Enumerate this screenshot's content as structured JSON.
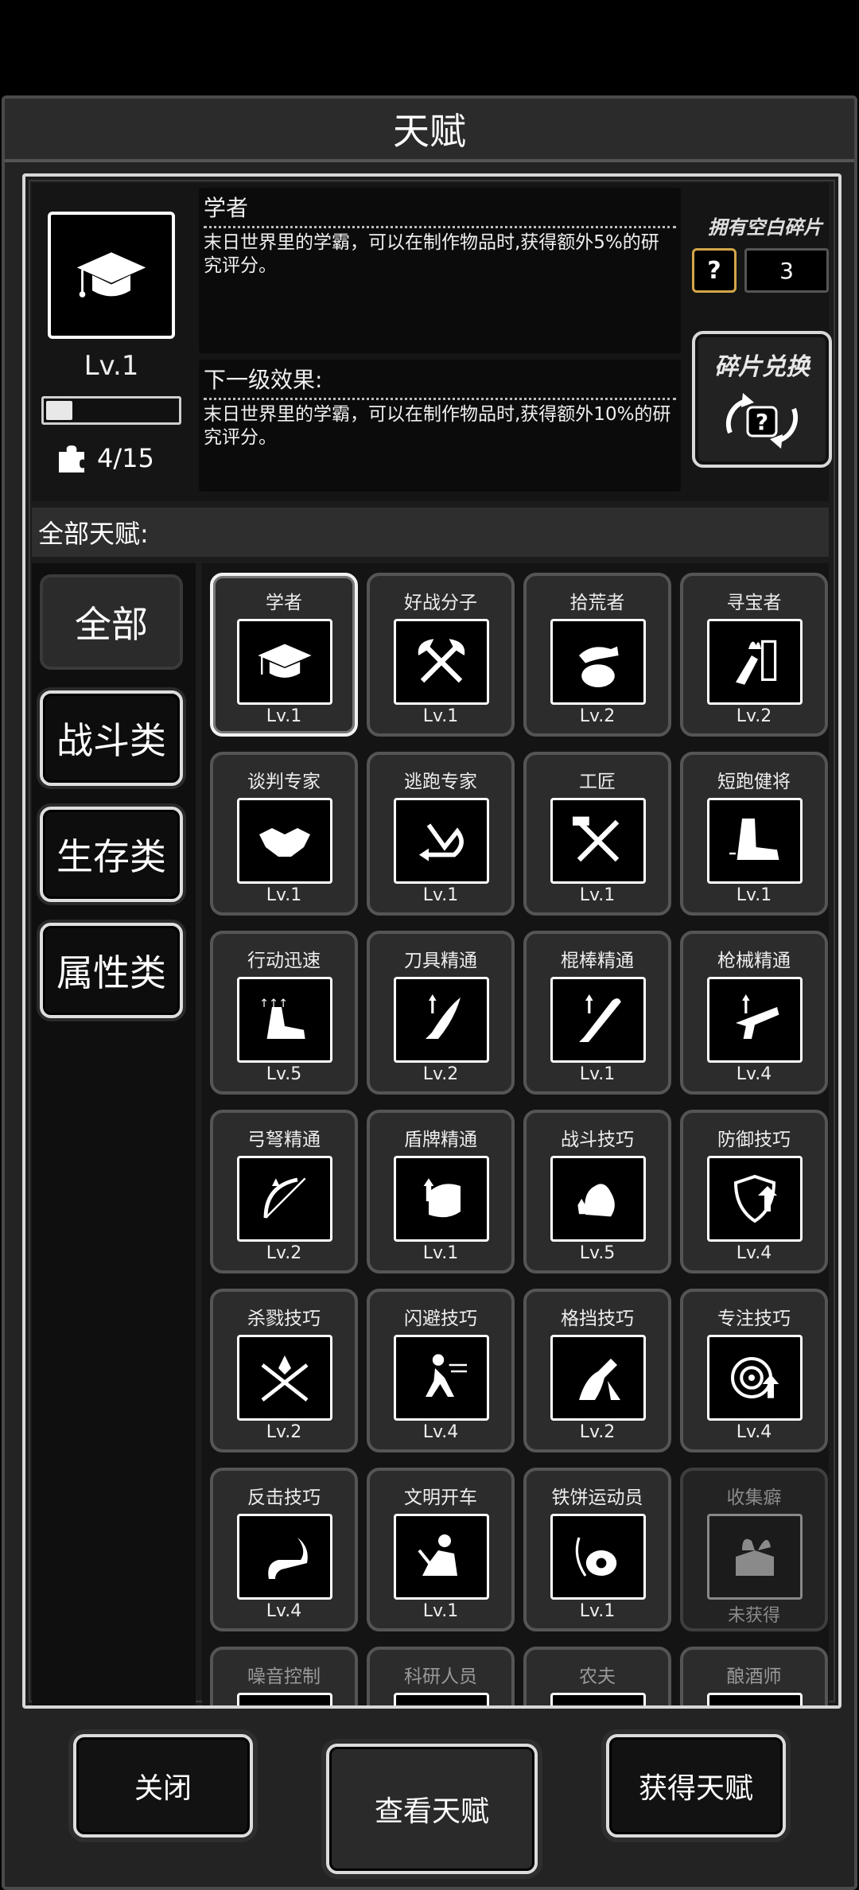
{
  "window": {
    "title": "天赋"
  },
  "current": {
    "name": "学者",
    "level_text": "Lv.1",
    "xp_progress": 0.2,
    "fragments_text": "4/15",
    "description": "末日世界里的学霸，可以在制作物品时,获得额外5%的研究评分。",
    "next_title": "下一级效果:",
    "next_description": "末日世界里的学霸，可以在制作物品时,获得额外10%的研究评分。"
  },
  "blank_fragments": {
    "label": "拥有空白碎片",
    "count": "3",
    "icon": "question-icon"
  },
  "exchange": {
    "label": "碎片兑换"
  },
  "all_talents_label": "全部天赋:",
  "categories": [
    {
      "label": "全部",
      "active": true
    },
    {
      "label": "战斗类",
      "active": false
    },
    {
      "label": "生存类",
      "active": false
    },
    {
      "label": "属性类",
      "active": false
    }
  ],
  "talents": [
    {
      "name": "学者",
      "level": "Lv.1",
      "icon": "graduation-cap-icon",
      "selected": true
    },
    {
      "name": "好战分子",
      "level": "Lv.1",
      "icon": "crossed-axes-icon"
    },
    {
      "name": "拾荒者",
      "level": "Lv.2",
      "icon": "scavenge-hand-icon"
    },
    {
      "name": "寻宝者",
      "level": "Lv.2",
      "icon": "treasure-hunt-icon"
    },
    {
      "name": "谈判专家",
      "level": "Lv.1",
      "icon": "handshake-icon"
    },
    {
      "name": "逃跑专家",
      "level": "Lv.1",
      "icon": "escape-arrow-icon"
    },
    {
      "name": "工匠",
      "level": "Lv.1",
      "icon": "hammer-saw-icon"
    },
    {
      "name": "短跑健将",
      "level": "Lv.1",
      "icon": "sprint-boot-icon"
    },
    {
      "name": "行动迅速",
      "level": "Lv.5",
      "icon": "fast-move-icon"
    },
    {
      "name": "刀具精通",
      "level": "Lv.2",
      "icon": "knife-icon"
    },
    {
      "name": "棍棒精通",
      "level": "Lv.1",
      "icon": "bat-icon"
    },
    {
      "name": "枪械精通",
      "level": "Lv.4",
      "icon": "gun-icon"
    },
    {
      "name": "弓弩精通",
      "level": "Lv.2",
      "icon": "bow-icon"
    },
    {
      "name": "盾牌精通",
      "level": "Lv.1",
      "icon": "shield-gauntlet-icon"
    },
    {
      "name": "战斗技巧",
      "level": "Lv.5",
      "icon": "flex-arm-icon"
    },
    {
      "name": "防御技巧",
      "level": "Lv.4",
      "icon": "defense-shield-icon"
    },
    {
      "name": "杀戮技巧",
      "level": "Lv.2",
      "icon": "crossed-swords-icon"
    },
    {
      "name": "闪避技巧",
      "level": "Lv.4",
      "icon": "dodge-icon"
    },
    {
      "name": "格挡技巧",
      "level": "Lv.2",
      "icon": "block-icon"
    },
    {
      "name": "专注技巧",
      "level": "Lv.4",
      "icon": "target-icon"
    },
    {
      "name": "反击技巧",
      "level": "Lv.4",
      "icon": "counter-claw-icon"
    },
    {
      "name": "文明开车",
      "level": "Lv.1",
      "icon": "driver-icon"
    },
    {
      "name": "铁饼运动员",
      "level": "Lv.1",
      "icon": "discus-icon"
    },
    {
      "name": "收集癖",
      "level": "未获得",
      "icon": "collect-box-icon",
      "locked": true
    },
    {
      "name": "噪音控制",
      "level": "",
      "icon": "noise-icon",
      "partial": true
    },
    {
      "name": "科研人员",
      "level": "",
      "icon": "research-icon",
      "partial": true
    },
    {
      "name": "农夫",
      "level": "",
      "icon": "farmer-icon",
      "partial": true
    },
    {
      "name": "酿酒师",
      "level": "",
      "icon": "brew-icon",
      "partial": true
    }
  ],
  "buttons": {
    "close": "关闭",
    "view": "查看天赋",
    "obtain": "获得天赋"
  }
}
